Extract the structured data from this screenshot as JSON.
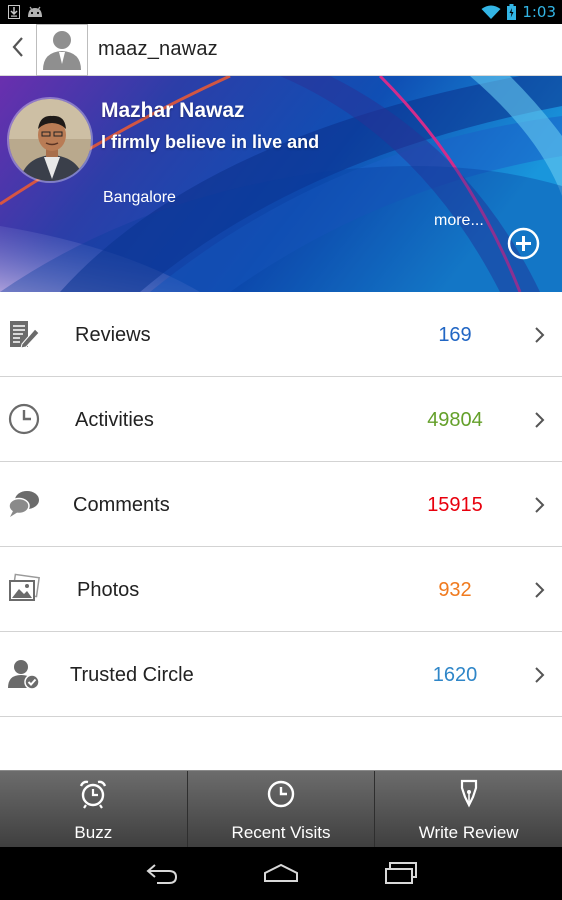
{
  "status_bar": {
    "time": "1:03",
    "icons": [
      "download-icon",
      "android-icon",
      "wifi-icon",
      "battery-icon"
    ]
  },
  "action_bar": {
    "username": "maaz_nawaz",
    "back_icon": "chevron-left-icon",
    "avatar_icon": "person-silhouette-icon"
  },
  "profile": {
    "name": "Mazhar Nawaz",
    "bio": "I firmly believe in live and",
    "location": "Bangalore",
    "more_label": "more...",
    "add_icon": "plus-circle-icon"
  },
  "stats": [
    {
      "label": "Reviews",
      "count": "169",
      "color": "#2166c4",
      "icon": "review-document-icon"
    },
    {
      "label": "Activities",
      "count": "49804",
      "color": "#64a02a",
      "icon": "clock-icon"
    },
    {
      "label": "Comments",
      "count": "15915",
      "color": "#e8000d",
      "icon": "chat-bubbles-icon"
    },
    {
      "label": "Photos",
      "count": "932",
      "color": "#f07a1e",
      "icon": "photos-icon"
    },
    {
      "label": "Trusted Circle",
      "count": "1620",
      "color": "#2f86c8",
      "icon": "user-check-icon"
    }
  ],
  "bottom_tabs": [
    {
      "label": "Buzz",
      "icon": "alarm-clock-icon"
    },
    {
      "label": "Recent Visits",
      "icon": "clock-icon"
    },
    {
      "label": "Write Review",
      "icon": "pen-nib-icon"
    }
  ],
  "nav_bar": {
    "icons": [
      "back-arrow-icon",
      "home-icon",
      "recent-apps-icon"
    ]
  }
}
